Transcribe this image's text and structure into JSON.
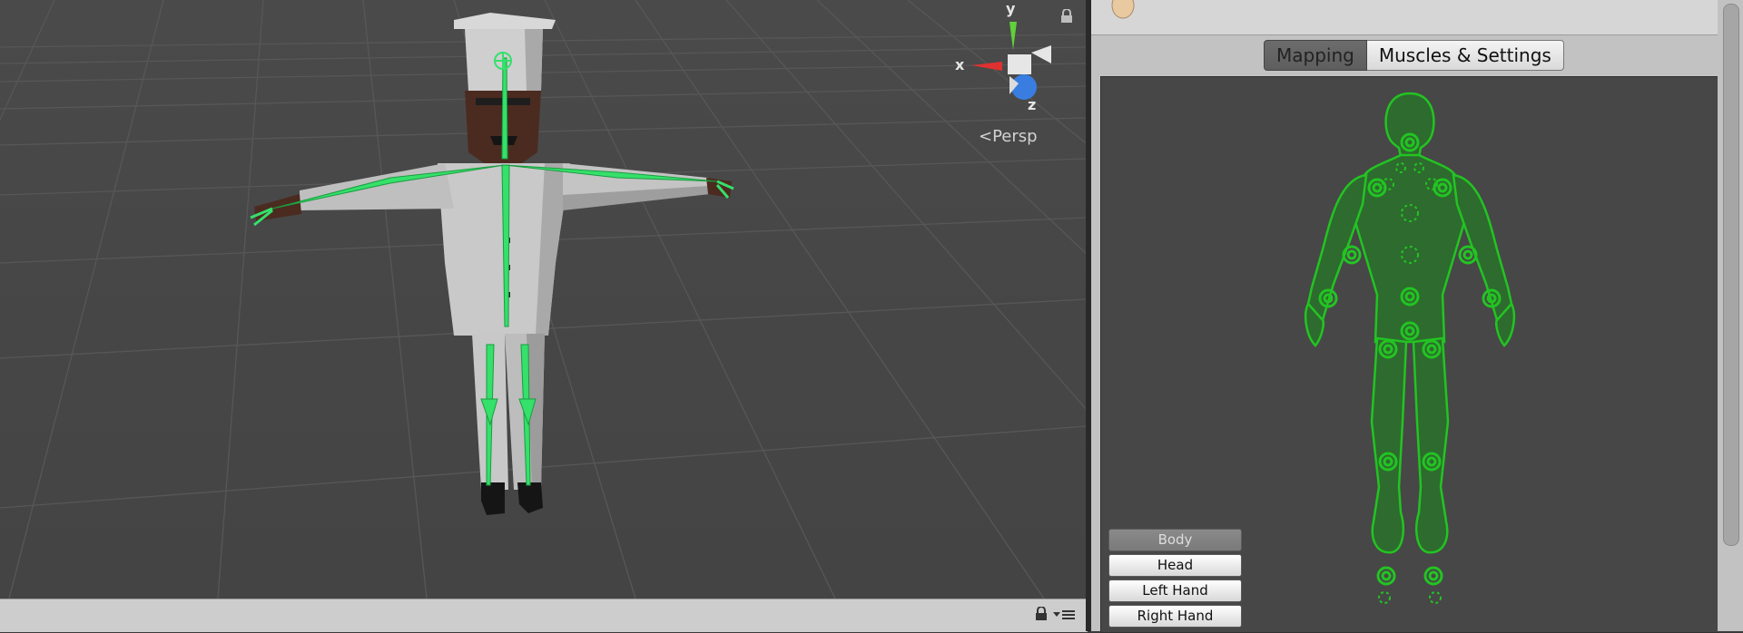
{
  "scene_view": {
    "projection_label": "Persp",
    "axis_labels": {
      "x": "x",
      "y": "y",
      "z": "z"
    }
  },
  "inspector": {
    "tabs": [
      {
        "label": "Mapping",
        "active": true
      },
      {
        "label": "Muscles & Settings",
        "active": false
      }
    ],
    "body_parts": [
      {
        "label": "Body",
        "active": true
      },
      {
        "label": "Head",
        "active": false
      },
      {
        "label": "Left Hand",
        "active": false
      },
      {
        "label": "Right Hand",
        "active": false
      }
    ]
  },
  "colors": {
    "bone_green": "#35e06b",
    "avatar_fill": "#2e6b2e",
    "avatar_stroke": "#22c422",
    "x_axis": "#e03131",
    "y_axis": "#5fd13a",
    "z_axis": "#3a7de0"
  },
  "icons": [
    "lock-icon",
    "menu-icon",
    "avatar-head-icon",
    "scene-gizmo-icon"
  ]
}
